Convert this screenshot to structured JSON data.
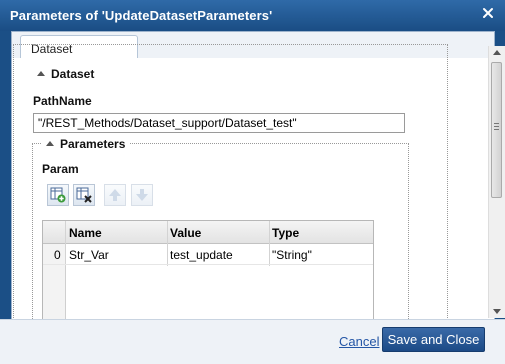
{
  "window": {
    "title": "Parameters of 'UpdateDatasetParameters'"
  },
  "tabs": [
    {
      "label": "Dataset"
    }
  ],
  "dataset_section": {
    "legend": "Dataset",
    "path_label": "PathName",
    "path_value": "\"/REST_Methods/Dataset_support/Dataset_test\""
  },
  "parameters_section": {
    "legend": "Parameters",
    "param_label": "Param",
    "grid": {
      "columns": [
        "Name",
        "Value",
        "Type"
      ],
      "rows": [
        {
          "index": "0",
          "name": "Str_Var",
          "value": "test_update",
          "type": "\"String\""
        }
      ]
    }
  },
  "footer": {
    "cancel_label": "Cancel",
    "save_label": "Save and Close"
  }
}
